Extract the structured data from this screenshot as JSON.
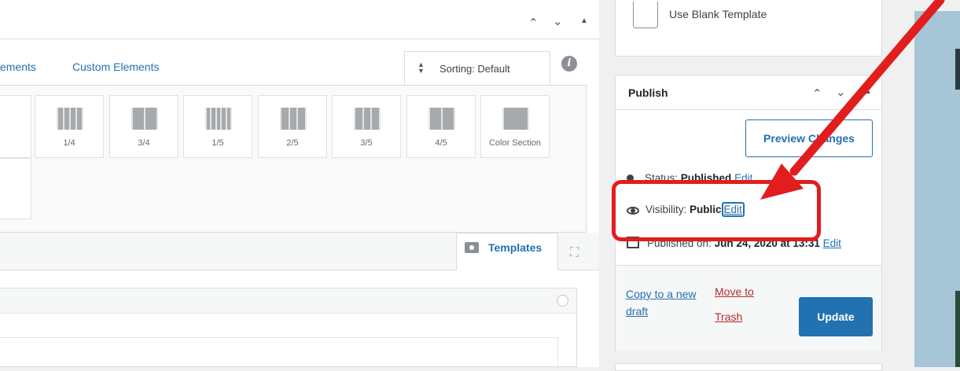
{
  "builder": {
    "tabs": [
      {
        "label": "ements"
      },
      {
        "label": "Custom Elements"
      }
    ],
    "sorting_label": "Sorting: Default",
    "elements": [
      {
        "label": "1/4",
        "cols": 4
      },
      {
        "label": "3/4",
        "cols": 2
      },
      {
        "label": "1/5",
        "cols": 5
      },
      {
        "label": "2/5",
        "cols": 3
      },
      {
        "label": "3/5",
        "cols": 3
      },
      {
        "label": "4/5",
        "cols": 2
      },
      {
        "label": "Color Section",
        "cols": 1
      }
    ],
    "templates_label": "Templates"
  },
  "sidebar": {
    "blank_template_label": "Use Blank Template",
    "publish": {
      "title": "Publish",
      "preview_label": "Preview Changes",
      "status_prefix": "Status: ",
      "status_value": "Published",
      "status_edit": "Edit",
      "visibility_prefix": "Visibility: ",
      "visibility_value": "Public",
      "visibility_edit": "Edit",
      "published_prefix": "Published on: ",
      "published_value": "Jun 24, 2020 at 13:31",
      "published_edit": "Edit",
      "copy_draft_label": "Copy to a new draft",
      "trash_label": "Move to Trash",
      "update_label": "Update"
    }
  },
  "annotation": {
    "color": "#e21d1d"
  }
}
